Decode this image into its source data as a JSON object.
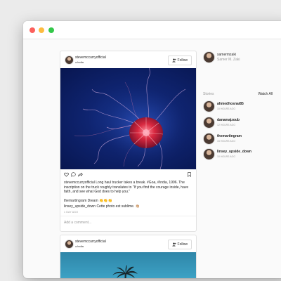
{
  "window": {
    "controls": [
      "close",
      "minimize",
      "maximize"
    ]
  },
  "post1": {
    "username": "stevemccurryofficial",
    "location": "India",
    "follow_label": "Follow",
    "caption": "stevemccurryofficial Long haul trucker takes a break. #Goa, #India, 1996. The inscription on the truck roughly translates to \"If you find the courage inside, have faith, and see what God does to help you.\"",
    "comments": [
      {
        "user": "themartingram",
        "text": "Dream 👏👏👏"
      },
      {
        "user": "linsey_upside_down",
        "text": "Cette photo est sublime. 👏🏼"
      }
    ],
    "time": "1 DAY AGO",
    "add_comment_placeholder": "Add a comment..."
  },
  "post2": {
    "username": "stevemccurryofficial",
    "location": "India",
    "follow_label": "Follow"
  },
  "sidebar": {
    "me": {
      "username": "samermzaki",
      "full_name": "Samer M. Zaki"
    },
    "stories_label": "Stories",
    "watch_all_label": "Watch All",
    "stories": [
      {
        "name": "ahmedhosnai85",
        "time": "10 HOURS AGO"
      },
      {
        "name": "danamajzoub",
        "time": "12 HOURS AGO"
      },
      {
        "name": "themartingram",
        "time": "15 HOURS AGO"
      },
      {
        "name": "linsey_upside_down",
        "time": "10 HOURS AGO"
      }
    ]
  },
  "colors": {
    "accent_red": "#fc605c",
    "accent_yellow": "#fdbc40",
    "accent_green": "#34c84a"
  }
}
